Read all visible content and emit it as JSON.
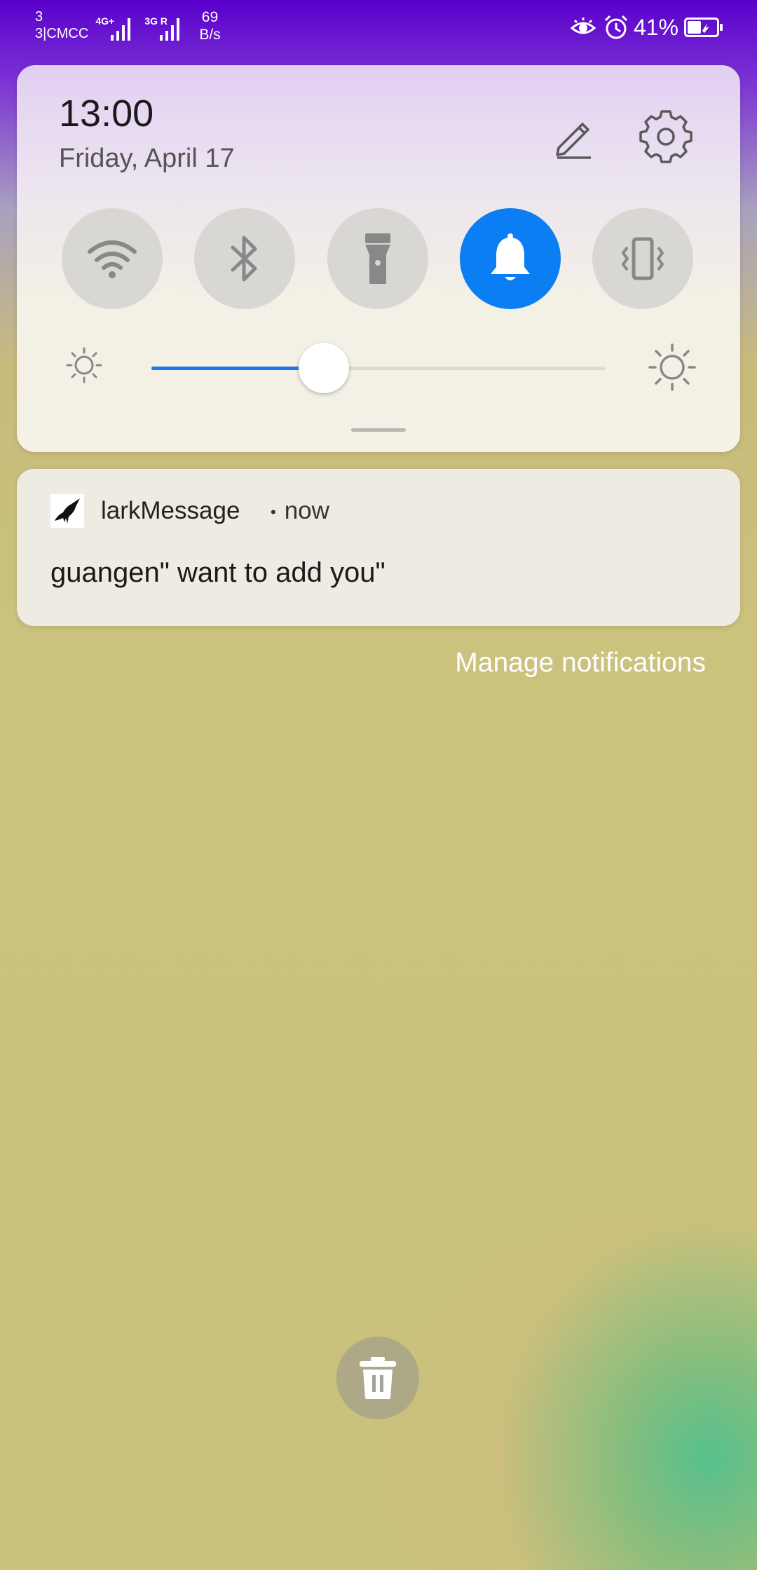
{
  "status_bar": {
    "sim_slot": "3",
    "carrier": "3|CMCC",
    "network1": "4G+",
    "network2": "3G R",
    "speed_value": "69",
    "speed_unit": "B/s",
    "battery_percent": "41%",
    "icons": [
      "eye-comfort-icon",
      "alarm-icon",
      "battery-icon"
    ]
  },
  "quick_settings": {
    "time": "13:00",
    "date": "Friday, April 17",
    "tiles": [
      {
        "name": "wifi",
        "icon": "wifi-icon",
        "active": false
      },
      {
        "name": "bluetooth",
        "icon": "bluetooth-icon",
        "active": false
      },
      {
        "name": "flashlight",
        "icon": "flashlight-icon",
        "active": false
      },
      {
        "name": "sound",
        "icon": "bell-icon",
        "active": true
      },
      {
        "name": "vibrate",
        "icon": "vibrate-icon",
        "active": false
      }
    ],
    "brightness_level": 0.38,
    "accent_color": "#0a7ef2"
  },
  "notification": {
    "app_name": "larkMessage",
    "time": "now",
    "body": "guangen\" want to add you\""
  },
  "manage_notifications": "Manage notifications"
}
